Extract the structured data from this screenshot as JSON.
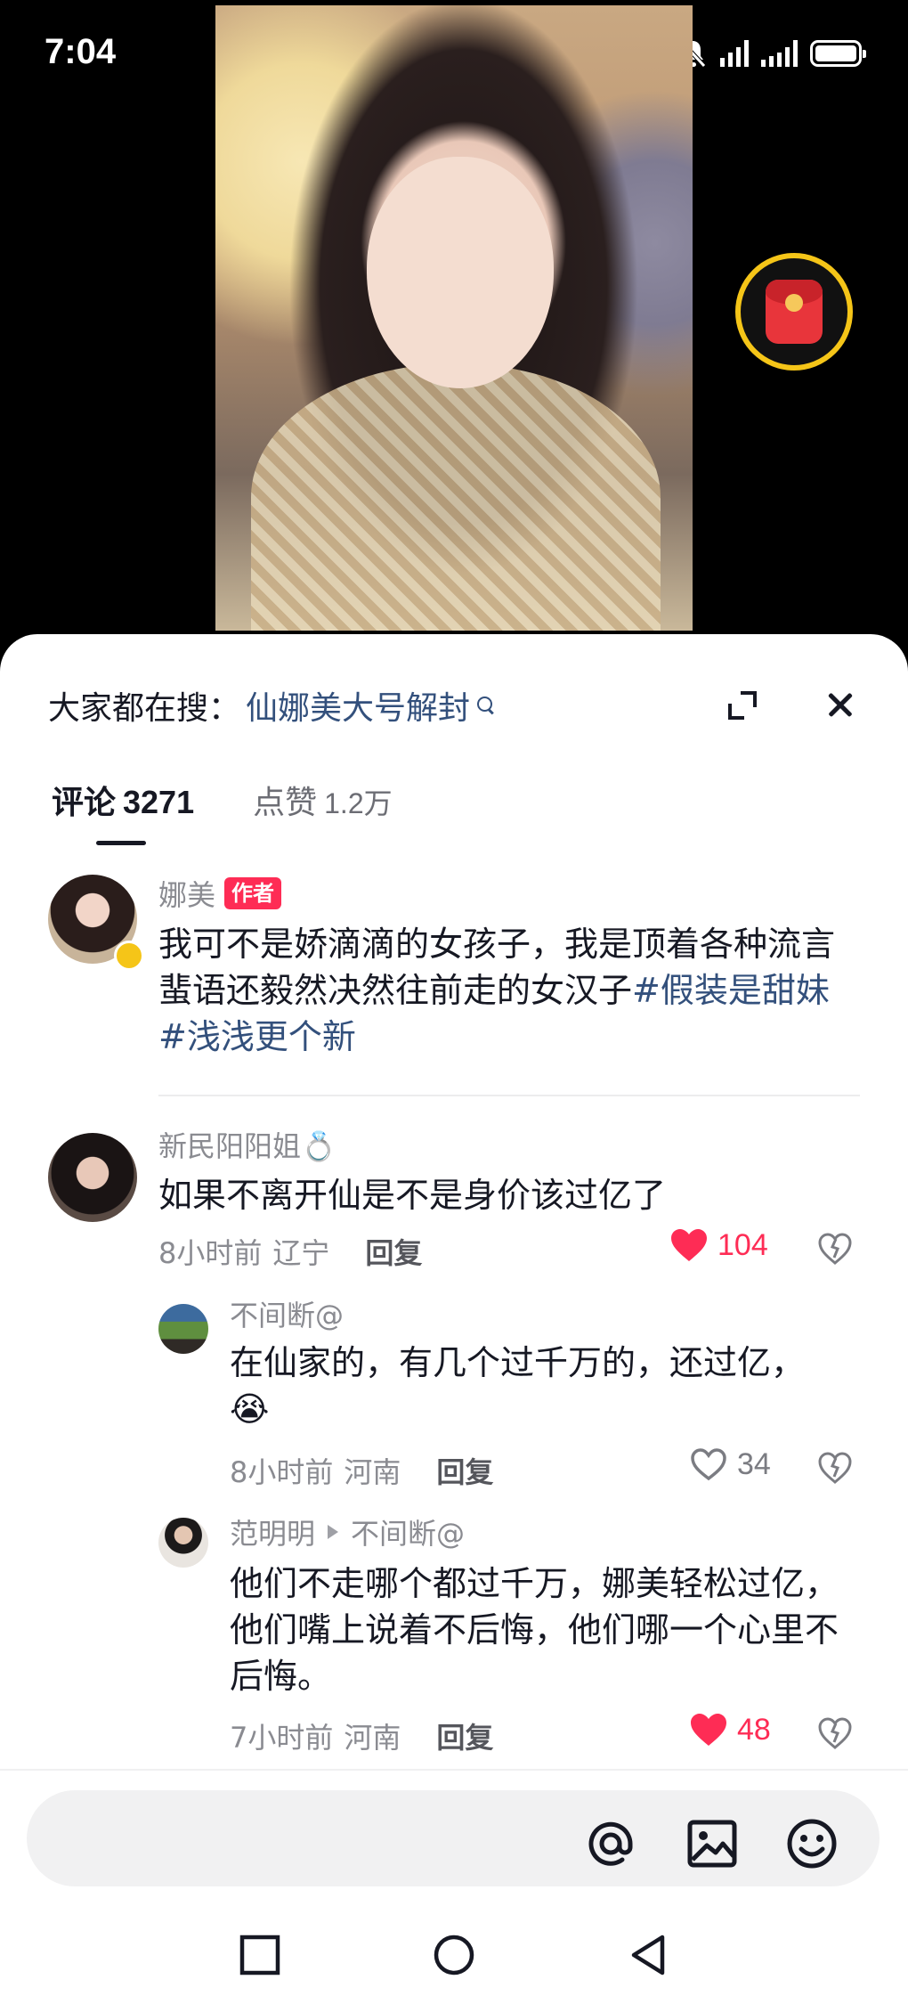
{
  "status_bar": {
    "time": "7:04"
  },
  "video": {
    "description_icon": "red-packet-icon"
  },
  "sheet": {
    "search_prefix": "大家都在搜：",
    "search_term": "仙娜美大号解封",
    "tabs": [
      {
        "label": "评论",
        "count": "3271"
      },
      {
        "label": "点赞",
        "count": "1.2万"
      }
    ]
  },
  "comments": [
    {
      "user": "娜美",
      "badge": "作者",
      "text_plain": "我可不是娇滴滴的女孩子，我是顶着各种流言蜚语还毅然决然往前走的女汉子",
      "tag1": "#假装是甜妹",
      "tag2": "#浅浅更个新"
    },
    {
      "user": "新民阳阳姐💍",
      "text": "如果不离开仙是不是身价该过亿了",
      "time": "8小时前",
      "location": "辽宁",
      "reply": "回复",
      "likes": "104",
      "liked": true
    },
    {
      "user": "不间断@",
      "text": "在仙家的，有几个过千万的，还过亿，😭",
      "time": "8小时前",
      "location": "河南",
      "reply": "回复",
      "likes": "34",
      "liked": false
    },
    {
      "user": "范明明",
      "reply_to": "不间断@",
      "text": "他们不走哪个都过千万，娜美轻松过亿，他们嘴上说着不后悔，他们哪一个心里不后悔。",
      "time": "7小时前",
      "location": "河南",
      "reply": "回复",
      "likes": "48",
      "liked": true
    }
  ],
  "input": {
    "placeholder": ""
  },
  "colors": {
    "accent": "#fe2c55",
    "link": "#33507c",
    "gold": "#f5c518"
  }
}
